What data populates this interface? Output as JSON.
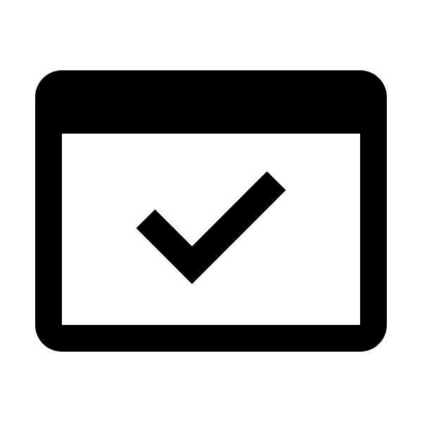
{
  "icon": {
    "name": "browser-window-check-icon",
    "parts": {
      "frame": "window-frame",
      "title_bar": "window-title-bar",
      "content_area": "window-content-area",
      "check": "check-icon"
    }
  },
  "colors": {
    "background": "#ffffff",
    "foreground": "#000000"
  }
}
